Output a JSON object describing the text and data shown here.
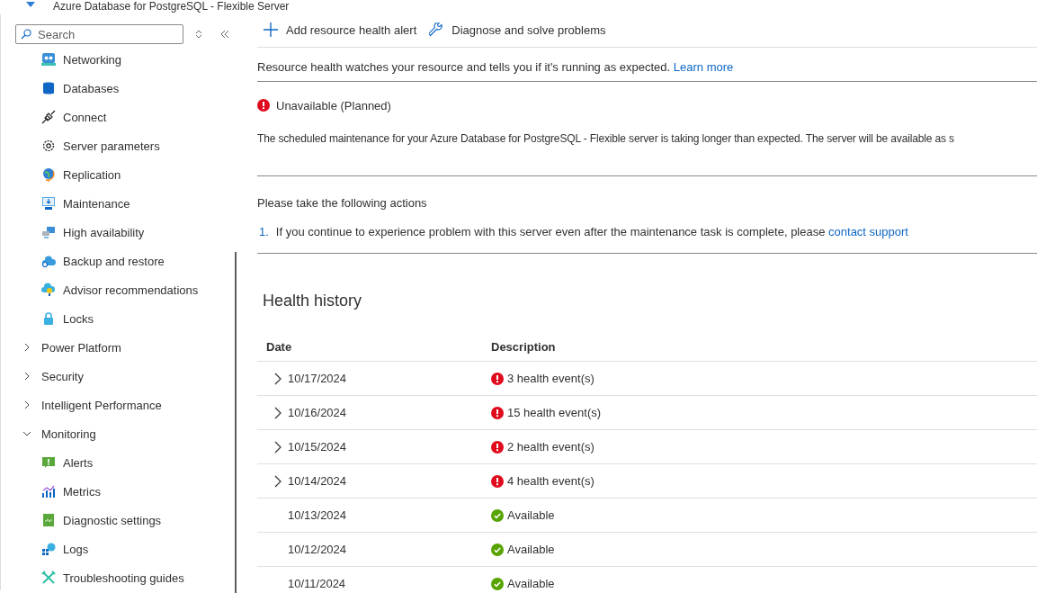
{
  "header": {
    "title": "Azure Database for PostgreSQL - Flexible Server"
  },
  "sidebar": {
    "search": {
      "placeholder": "Search"
    },
    "items": [
      {
        "kind": "network",
        "label": "Networking"
      },
      {
        "kind": "database",
        "label": "Databases"
      },
      {
        "kind": "plug",
        "label": "Connect"
      },
      {
        "kind": "gear",
        "label": "Server parameters"
      },
      {
        "kind": "globe",
        "label": "Replication"
      },
      {
        "kind": "monitor",
        "label": "Maintenance"
      },
      {
        "kind": "servers",
        "label": "High availability"
      },
      {
        "kind": "cloud",
        "label": "Backup and restore"
      },
      {
        "kind": "bulb",
        "label": "Advisor recommendations"
      },
      {
        "kind": "lock",
        "label": "Locks"
      },
      {
        "kind": "group",
        "label": "Power Platform",
        "expanded": false
      },
      {
        "kind": "group",
        "label": "Security",
        "expanded": false
      },
      {
        "kind": "group",
        "label": "Intelligent Performance",
        "expanded": false
      },
      {
        "kind": "group",
        "label": "Monitoring",
        "expanded": true,
        "children": [
          {
            "kind": "alert",
            "label": "Alerts"
          },
          {
            "kind": "chart",
            "label": "Metrics"
          },
          {
            "kind": "diag",
            "label": "Diagnostic settings"
          },
          {
            "kind": "logs",
            "label": "Logs"
          },
          {
            "kind": "tools",
            "label": "Troubleshooting guides"
          }
        ]
      }
    ]
  },
  "toolbar": [
    {
      "kind": "add",
      "label": "Add resource health alert"
    },
    {
      "kind": "diagnose",
      "label": "Diagnose and solve problems"
    }
  ],
  "intro": {
    "text": "Resource health watches your resource and tells you if it's running as expected.",
    "link": "Learn more"
  },
  "status": {
    "kind": "unavailable",
    "title": "Unavailable (Planned)",
    "message": "The scheduled maintenance for your Azure Database for PostgreSQL - Flexible server is taking longer than expected. The server will be available as s"
  },
  "actions": {
    "heading": "Please take the following actions",
    "items": [
      {
        "number": "1.",
        "text": "If you continue to experience problem with this server even after the maintenance task is complete, please",
        "link": "contact support"
      }
    ]
  },
  "health_history": {
    "title": "Health history",
    "columns": [
      "Date",
      "Description"
    ],
    "rows": [
      {
        "kind": "unavailable",
        "expanded": false,
        "date": "10/17/2024",
        "description": "3 health event(s)"
      },
      {
        "kind": "unavailable",
        "expanded": false,
        "date": "10/16/2024",
        "description": "15 health event(s)"
      },
      {
        "kind": "unavailable",
        "expanded": false,
        "date": "10/15/2024",
        "description": "2 health event(s)"
      },
      {
        "kind": "unavailable",
        "expanded": false,
        "date": "10/14/2024",
        "description": "4 health event(s)"
      },
      {
        "kind": "available",
        "date": "10/13/2024",
        "description": "Available"
      },
      {
        "kind": "available",
        "date": "10/12/2024",
        "description": "Available"
      },
      {
        "kind": "available",
        "date": "10/11/2024",
        "description": "Available"
      }
    ]
  }
}
